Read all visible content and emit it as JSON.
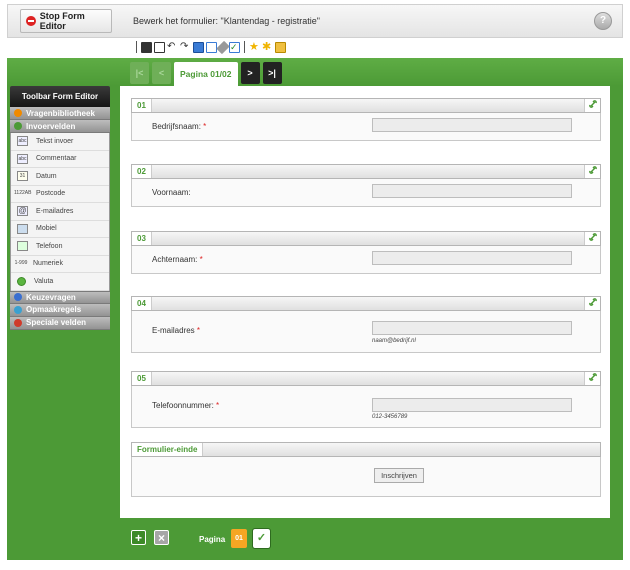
{
  "topbar": {
    "stop_label": "Stop Form Editor",
    "edit_label": "Bewerk het formulier:  \"Klantendag - registratie\"",
    "help_symbol": "?"
  },
  "toolbar_icons": [
    "save-icon",
    "preview-icon",
    "undo-icon",
    "redo-icon",
    "layout-columns-icon",
    "layout-rows-icon",
    "wrench-icon",
    "check-icon",
    "star-icon",
    "star-add-icon",
    "folder-star-icon"
  ],
  "sidebar": {
    "title": "Toolbar Form Editor",
    "sections": {
      "vragenbibliotheek": "Vragenbibliotheek",
      "invoervelden": "Invoervelden",
      "keuzevragen": "Keuzevragen",
      "opmaakregels": "Opmaakregels",
      "speciale": "Speciale velden"
    },
    "items": [
      {
        "label": "Tekst invoer",
        "icon": "abc"
      },
      {
        "label": "Commentaar",
        "icon": "abc"
      },
      {
        "label": "Datum",
        "icon": "31"
      },
      {
        "label": "Postcode",
        "icon": "1122AB"
      },
      {
        "label": "E-mailadres",
        "icon": "@"
      },
      {
        "label": "Mobiel",
        "icon": "phone"
      },
      {
        "label": "Telefoon",
        "icon": "phone"
      },
      {
        "label": "Numeriek",
        "icon": "1-999"
      },
      {
        "label": "Valuta",
        "icon": "$"
      }
    ]
  },
  "pager": {
    "first": "|<",
    "prev": "<",
    "current": "Pagina 01/02",
    "next": ">",
    "last": ">|"
  },
  "fields": [
    {
      "num": "01",
      "label": "Bedrijfsnaam:",
      "required": "*",
      "hint": ""
    },
    {
      "num": "02",
      "label": "Voornaam:",
      "required": "",
      "hint": ""
    },
    {
      "num": "03",
      "label": "Achternaam:",
      "required": "*",
      "hint": ""
    },
    {
      "num": "04",
      "label": "E-mailadres",
      "required": "*",
      "hint": "naam@bedrijf.nl"
    },
    {
      "num": "05",
      "label": "Telefoonnummer:",
      "required": "*",
      "hint": "012-3456789"
    }
  ],
  "form_end": {
    "title": "Formulier-einde",
    "submit": "Inschrijven"
  },
  "bottom": {
    "add": "+",
    "delete": "×",
    "page_label": "Pagina",
    "page_num": "01",
    "check": "✓"
  },
  "colors": {
    "green": "#4c9a36",
    "accent_orange": "#f5a623",
    "required_red": "#dd2222"
  }
}
